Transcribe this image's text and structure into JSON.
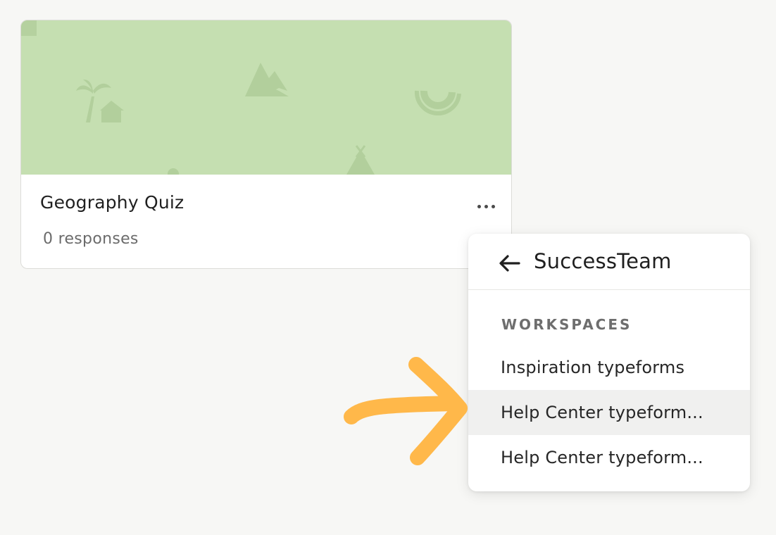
{
  "card": {
    "title": "Geography Quiz",
    "responses": "0 responses",
    "thumbnail_color": "#c5dfb1",
    "thumbnail_icons": [
      "palm-house-icon",
      "mountain-icon",
      "watermelon-icon",
      "tent-icon"
    ]
  },
  "menu": {
    "title": "SuccessTeam",
    "section_label": "WORKSPACES",
    "items": [
      {
        "label": "Inspiration typeforms",
        "active": false
      },
      {
        "label": "Help Center typeform...",
        "active": true
      },
      {
        "label": "Help Center typeform...",
        "active": false
      }
    ]
  },
  "annotation": {
    "color": "#ffb84a",
    "icon": "pointer-arrow-icon"
  }
}
